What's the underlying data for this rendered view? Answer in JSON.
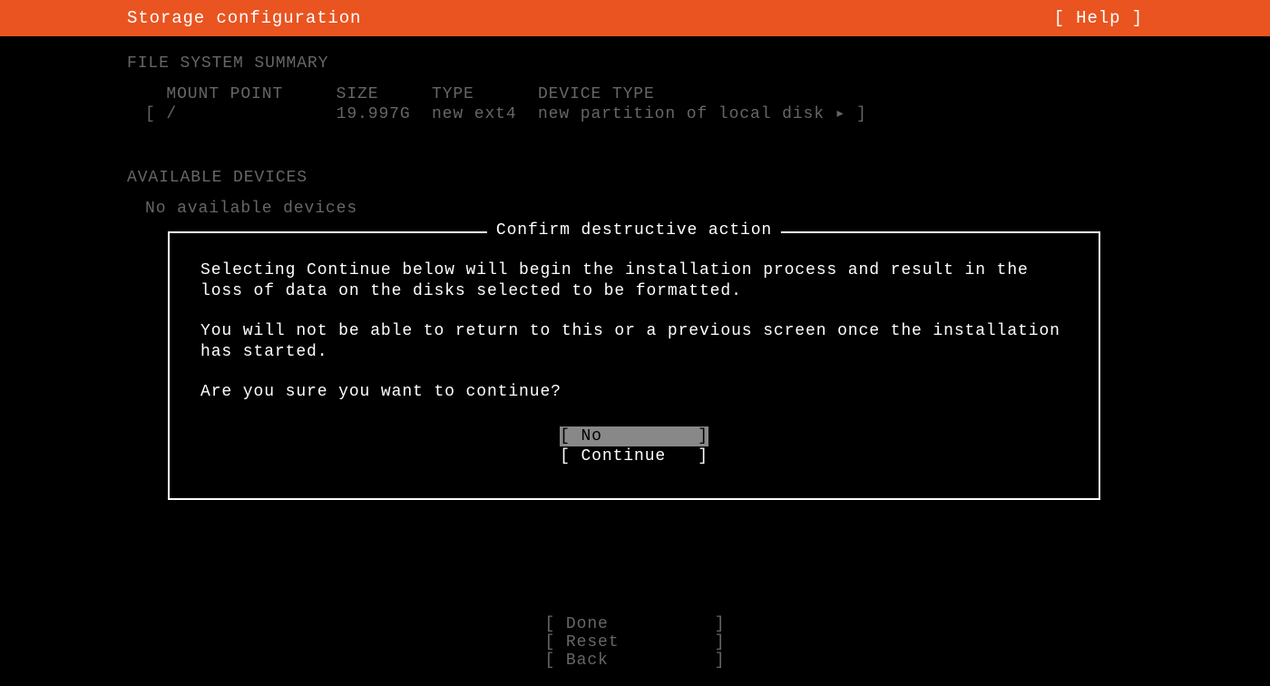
{
  "header": {
    "title": "Storage configuration",
    "help": "[ Help ]"
  },
  "fs_summary": {
    "title": "FILE SYSTEM SUMMARY",
    "header_line": "  MOUNT POINT     SIZE     TYPE      DEVICE TYPE",
    "row_line": "[ /               19.997G  new ext4  new partition of local disk ▸ ]"
  },
  "available": {
    "title": "AVAILABLE DEVICES",
    "none": "No available devices"
  },
  "dialog": {
    "title": " Confirm destructive action ",
    "p1": "Selecting Continue below will begin the installation process and result in the loss of data on the disks selected to be formatted.",
    "p2": "You will not be able to return to this or a previous screen once the installation has started.",
    "p3": "Are you sure you want to continue?",
    "btn_no": "[ No         ]",
    "btn_continue": "[ Continue   ]"
  },
  "footer": {
    "done": "[ Done          ]",
    "reset": "[ Reset         ]",
    "back": "[ Back          ]"
  }
}
